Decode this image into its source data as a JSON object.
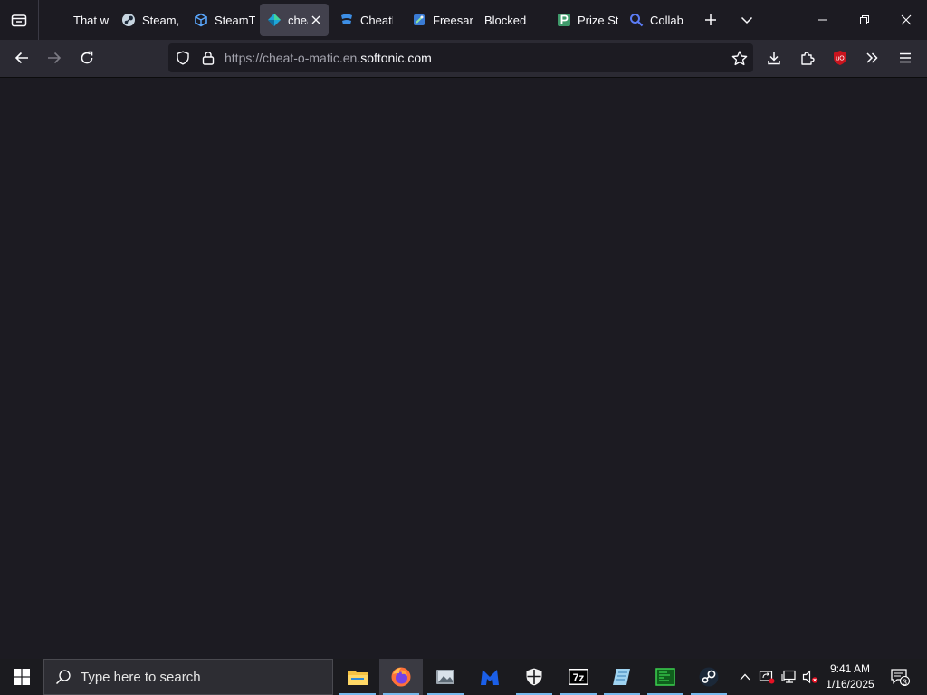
{
  "browser": {
    "tabs": [
      {
        "title": "That w",
        "icon": "generic-page-icon",
        "active": false
      },
      {
        "title": "Steam,",
        "icon": "steam-icon",
        "active": false
      },
      {
        "title": "SteamT",
        "icon": "cube-icon",
        "active": false
      },
      {
        "title": "chea",
        "icon": "softonic-icon",
        "active": true
      },
      {
        "title": "CheatE",
        "icon": "cheatengine-icon",
        "active": false
      },
      {
        "title": "Freesar",
        "icon": "freesar-icon",
        "active": false
      },
      {
        "title": "Blocked",
        "icon": "blank-icon",
        "active": false
      },
      {
        "title": "Prize St",
        "icon": "p-icon",
        "active": false
      },
      {
        "title": "Collab",
        "icon": "search-icon",
        "active": false
      }
    ],
    "url": {
      "prefix": "https://cheat-o-matic.en.",
      "domain": "softonic.com"
    }
  },
  "taskbar": {
    "search_placeholder": "Type here to search",
    "clock": {
      "time": "9:41 AM",
      "date": "1/16/2025"
    },
    "notification_count": "3",
    "apps": [
      "file-explorer-icon",
      "firefox-icon",
      "photos-icon",
      "malwarebytes-icon",
      "shield-icon",
      "7zip-icon",
      "notepad-icon",
      "terminal-icon",
      "steam-icon"
    ]
  },
  "colors": {
    "accent_blue": "#76b9ed",
    "ublock_red": "#c9141e",
    "page_background": "#1c1b22"
  }
}
